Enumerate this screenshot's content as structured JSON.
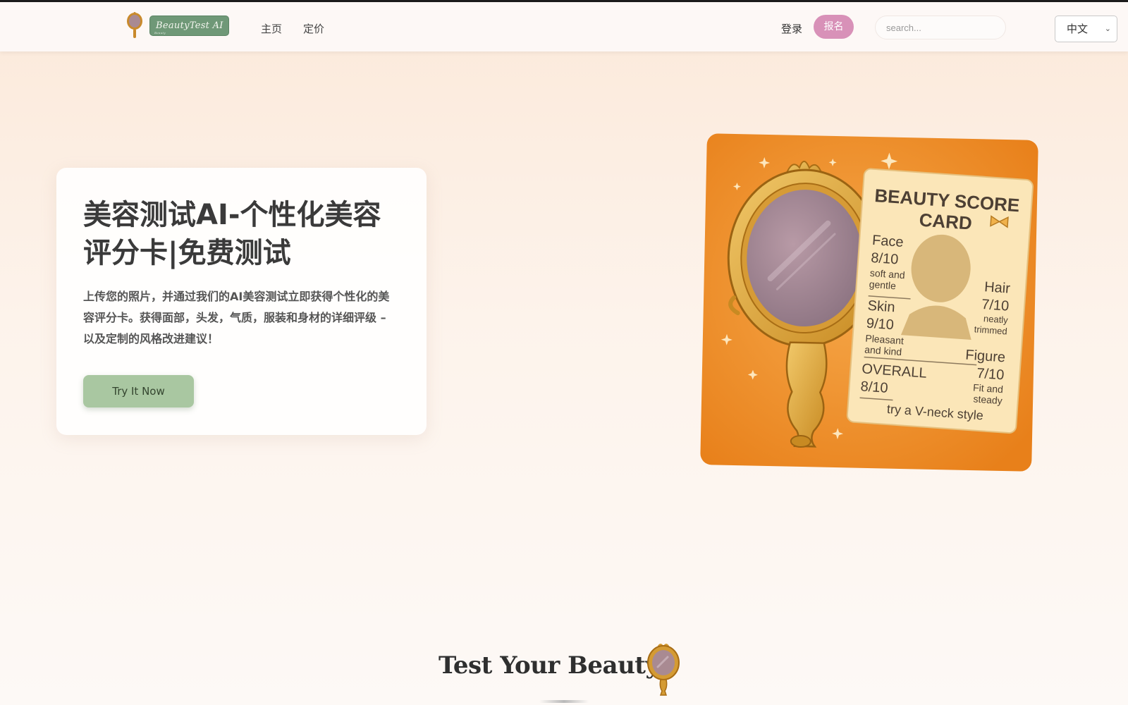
{
  "header": {
    "logo_text": "BeautyTest AI",
    "logo_tagline": "Beauty",
    "nav": {
      "home": "主页",
      "pricing": "定价"
    },
    "login": "登录",
    "signup": "报名",
    "search_placeholder": "search...",
    "language": "中文"
  },
  "hero": {
    "title": "美容测试AI-个性化美容评分卡|免费测试",
    "description": "上传您的照片，并通过我们的AI美容测试立即获得个性化的美容评分卡。获得面部，头发，气质，服装和身材的详细评级 – 以及定制的风格改进建议！",
    "cta": "Try It Now"
  },
  "score_card": {
    "title_line1": "BEAUTY SCORE",
    "title_line2": "CARD",
    "face_label": "Face",
    "face_score": "8/10",
    "face_note_1": "soft and",
    "face_note_2": "gentle",
    "hair_label": "Hair",
    "hair_score": "7/10",
    "hair_note_1": "neatly",
    "hair_note_2": "trimmed",
    "skin_label": "Skin",
    "skin_score": "9/10",
    "skin_note_1": "Pleasant",
    "skin_note_2": "and kind",
    "figure_label": "Figure",
    "figure_score": "7/10",
    "figure_note_1": "Fit and",
    "figure_note_2": "steady",
    "overall_label": "OVERALL",
    "overall_score": "8/10",
    "tip": "try a V-neck style"
  },
  "section": {
    "title": "Test Your Beauty"
  },
  "colors": {
    "accent_green": "#a9c7a1",
    "signup_pink": "#d891b8",
    "card_orange": "#f08c22",
    "logo_green": "#6f9877"
  }
}
